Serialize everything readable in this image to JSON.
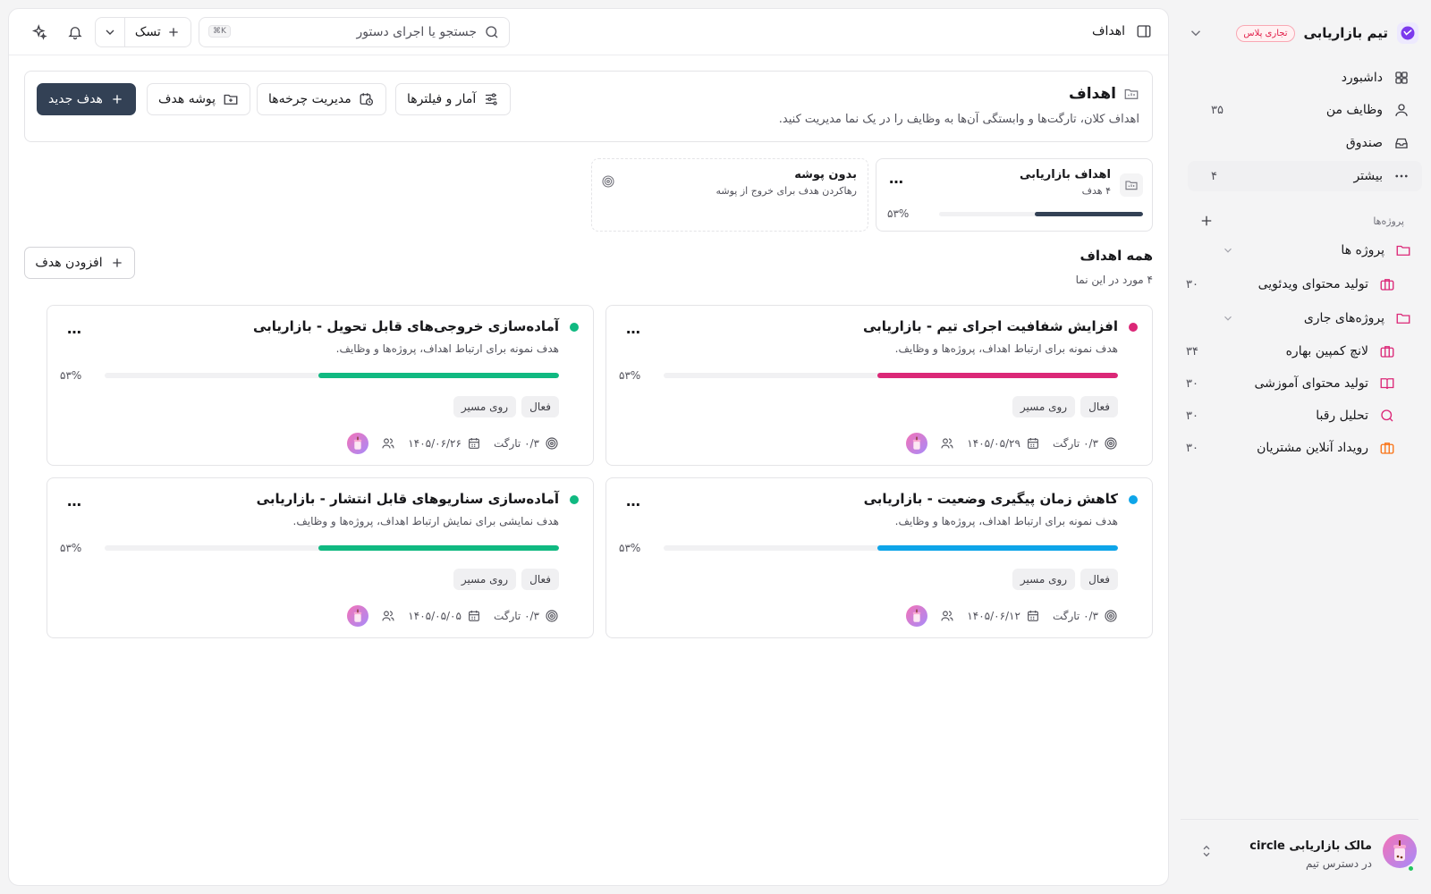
{
  "workspace": {
    "name": "تیم بازاریابی",
    "plan_badge": "تجاری پلاس"
  },
  "sidebar": {
    "nav": [
      {
        "label": "داشبورد",
        "count": ""
      },
      {
        "label": "وظایف من",
        "count": "۳۵"
      },
      {
        "label": "صندوق",
        "count": ""
      },
      {
        "label": "بیشتر",
        "count": "۴"
      }
    ],
    "projects_heading": "پروژه‌ها",
    "groups": [
      {
        "label": "پروژه ها",
        "items": [
          {
            "label": "تولید محتوای ویدئویی",
            "count": "۳۰"
          }
        ]
      },
      {
        "label": "پروژه‌های جاری",
        "items": [
          {
            "label": "لانچ کمپین بهاره",
            "count": "۳۴"
          },
          {
            "label": "تولید محتوای آموزشی",
            "count": "۳۰"
          },
          {
            "label": "تحلیل رقبا",
            "count": "۳۰"
          },
          {
            "label": "رویداد آنلاین مشتریان",
            "count": "۳۰"
          }
        ]
      }
    ],
    "user": {
      "name": "مالک بازاریابی circle",
      "status": "در دسترس تیم"
    }
  },
  "topbar": {
    "page_title": "اهداف",
    "search_placeholder": "جستجو یا اجرای دستور",
    "shortcut": "⌘K",
    "task_label": "تسک"
  },
  "header": {
    "title": "اهداف",
    "subtitle": "اهداف کلان، تارگت‌ها و وابستگی آن‌ها به وظایف را در یک نما مدیریت کنید.",
    "buttons": {
      "stats": "آمار و فیلترها",
      "cycles": "مدیریت چرخه‌ها",
      "folder": "پوشه هدف",
      "new_goal": "هدف جدید"
    }
  },
  "folders": [
    {
      "name": "اهداف بازاریابی",
      "count": "۴ هدف",
      "percent_label": "۵۳%",
      "progress": 0.53
    },
    {
      "name": "بدون پوشه",
      "desc": "رهاکردن هدف برای خروج از پوشه"
    }
  ],
  "all_goals": {
    "title": "همه اهداف",
    "subtitle": "۴ مورد در این نما",
    "add_label": "افزودن هدف"
  },
  "colors": {
    "pink": "#db2777",
    "green": "#10b981",
    "blue": "#0ea5e9",
    "slate": "#334155"
  },
  "goals": [
    {
      "title": "افزایش شفافیت اجرای تیم - بازاریابی",
      "desc": "هدف نمونه برای ارتباط اهداف، پروژه‌ها و وظایف.",
      "percent_label": "۵۳%",
      "progress": 0.53,
      "tag1": "فعال",
      "tag2": "روی مسیر",
      "targets": "۰/۳ تارگت",
      "date": "۱۴۰۵/۰۵/۲۹",
      "color": "#db2777"
    },
    {
      "title": "آماده‌سازی خروجی‌های قابل تحویل - بازاریابی",
      "desc": "هدف نمونه برای ارتباط اهداف، پروژه‌ها و وظایف.",
      "percent_label": "۵۳%",
      "progress": 0.53,
      "tag1": "فعال",
      "tag2": "روی مسیر",
      "targets": "۰/۳ تارگت",
      "date": "۱۴۰۵/۰۶/۲۶",
      "color": "#10b981"
    },
    {
      "title": "کاهش زمان پیگیری وضعیت - بازاریابی",
      "desc": "هدف نمونه برای ارتباط اهداف، پروژه‌ها و وظایف.",
      "percent_label": "۵۳%",
      "progress": 0.53,
      "tag1": "فعال",
      "tag2": "روی مسیر",
      "targets": "۰/۳ تارگت",
      "date": "۱۴۰۵/۰۶/۱۲",
      "color": "#0ea5e9"
    },
    {
      "title": "آماده‌سازی سناریوهای قابل انتشار - بازاریابی",
      "desc": "هدف نمایشی برای نمایش ارتباط اهداف، پروژه‌ها و وظایف.",
      "percent_label": "۵۳%",
      "progress": 0.53,
      "tag1": "فعال",
      "tag2": "روی مسیر",
      "targets": "۰/۳ تارگت",
      "date": "۱۴۰۵/۰۵/۰۵",
      "color": "#10b981"
    }
  ]
}
